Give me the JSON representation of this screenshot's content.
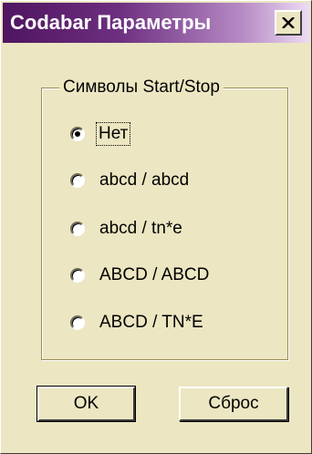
{
  "window": {
    "title": "Codabar Параметры"
  },
  "group": {
    "label": "Символы Start/Stop",
    "options": [
      {
        "label": "Нет",
        "selected": true
      },
      {
        "label": "abcd / abcd",
        "selected": false
      },
      {
        "label": "abcd / tn*e",
        "selected": false
      },
      {
        "label": "ABCD / ABCD",
        "selected": false
      },
      {
        "label": "ABCD / TN*E",
        "selected": false
      }
    ]
  },
  "buttons": {
    "ok_label": "OK",
    "reset_label": "Сброс"
  },
  "icons": {
    "close": "close-icon"
  },
  "colors": {
    "face": "#ece6c2",
    "title_start": "#4f1560",
    "title_end": "#eddcf4"
  }
}
